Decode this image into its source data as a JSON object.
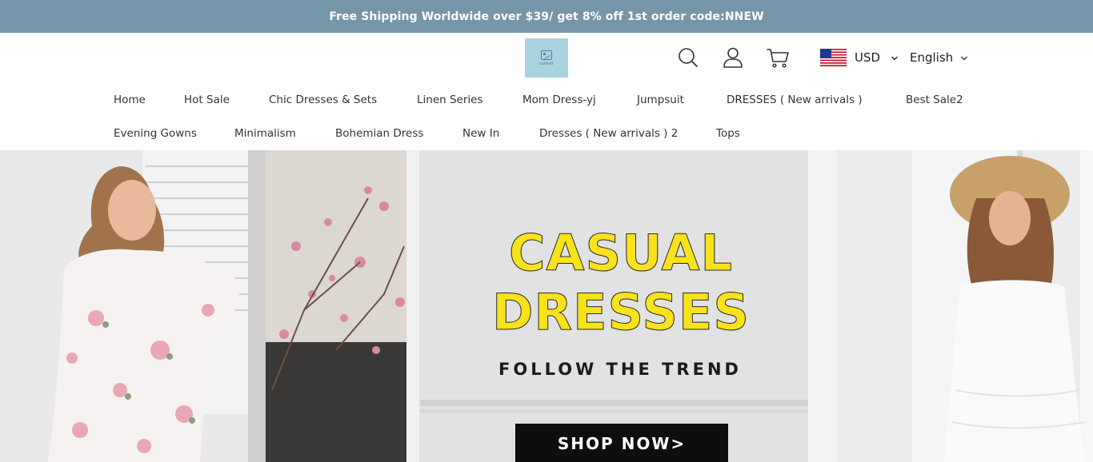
{
  "announcement": "Free Shipping Worldwide over $39/ get 8% off 1st order code:NNEW",
  "logo": {
    "text": "coreart"
  },
  "header_icons": [
    "search-icon",
    "account-icon",
    "cart-icon"
  ],
  "currency": {
    "flag": "us-flag-icon",
    "value": "USD"
  },
  "language": {
    "value": "English"
  },
  "nav": {
    "row1": [
      "Home",
      "Hot Sale",
      "Chic Dresses & Sets",
      "Linen Series",
      "Mom Dress-yj",
      "Jumpsuit",
      "DRESSES ( New arrivals )",
      "Best Sale2"
    ],
    "row2": [
      "Evening Gowns",
      "Minimalism",
      "Bohemian Dress",
      "New In",
      "Dresses ( New arrivals ) 2",
      "Tops"
    ]
  },
  "hero": {
    "title_line1": "CASUAL",
    "title_line2": "DRESSES",
    "subtitle": "FOLLOW THE TREND",
    "cta": "SHOP NOW>"
  },
  "colors": {
    "announcement_bg": "#7595a9",
    "logo_bg": "#a9d3e1",
    "hero_title": "#f7e21c",
    "cta_bg": "#0e0e0e"
  }
}
